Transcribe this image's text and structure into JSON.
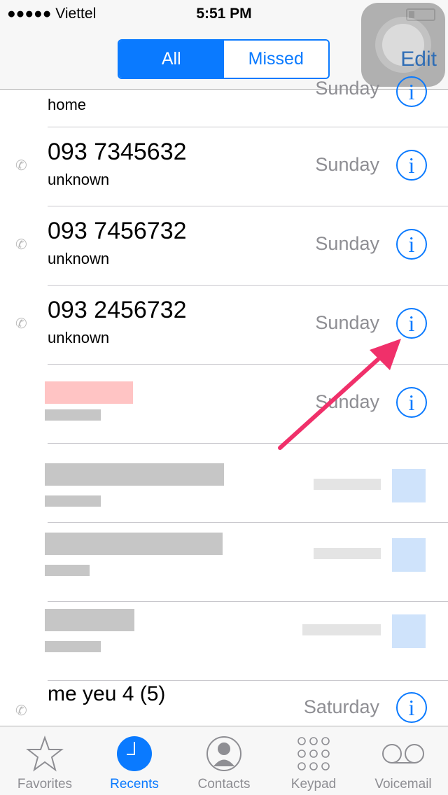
{
  "status_bar": {
    "carrier": "●●●●● Viettel",
    "time": "5:51 PM"
  },
  "nav": {
    "segments": [
      "All",
      "Missed"
    ],
    "selected": "All",
    "edit": "Edit"
  },
  "calls": [
    {
      "number": "",
      "label": "home",
      "day": "Sunday"
    },
    {
      "number": "093 7345632",
      "label": "unknown",
      "day": "Sunday"
    },
    {
      "number": "093 7456732",
      "label": "unknown",
      "day": "Sunday"
    },
    {
      "number": "093 2456732",
      "label": "unknown",
      "day": "Sunday"
    },
    {
      "number": "",
      "label": "",
      "day": "Sunday"
    },
    {
      "number": "",
      "label": "",
      "day": ""
    },
    {
      "number": "",
      "label": "",
      "day": ""
    },
    {
      "number": "",
      "label": "",
      "day": ""
    },
    {
      "number": "me yeu  4  (5)",
      "label": "",
      "day": "Saturday"
    }
  ],
  "tabs": [
    {
      "label": "Favorites"
    },
    {
      "label": "Recents"
    },
    {
      "label": "Contacts"
    },
    {
      "label": "Keypad"
    },
    {
      "label": "Voicemail"
    }
  ],
  "info_glyph": "i",
  "phone_glyph": "✆"
}
